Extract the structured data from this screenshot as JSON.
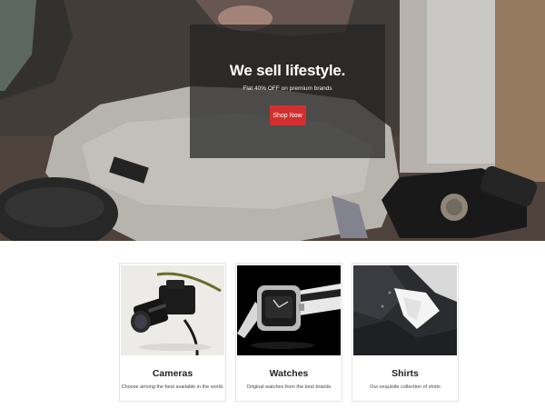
{
  "hero": {
    "title": "We sell lifestyle.",
    "subtitle": "Flat 40% OFF on premium brands",
    "cta_label": "Shop Now"
  },
  "products": [
    {
      "title": "Cameras",
      "description": "Choose among the best available in the world."
    },
    {
      "title": "Watches",
      "description": "Original watches from the best brands"
    },
    {
      "title": "Shirts",
      "description": "Our exquisite collection of shirts"
    }
  ],
  "colors": {
    "accent": "#d32f2f",
    "overlay": "#232323"
  }
}
